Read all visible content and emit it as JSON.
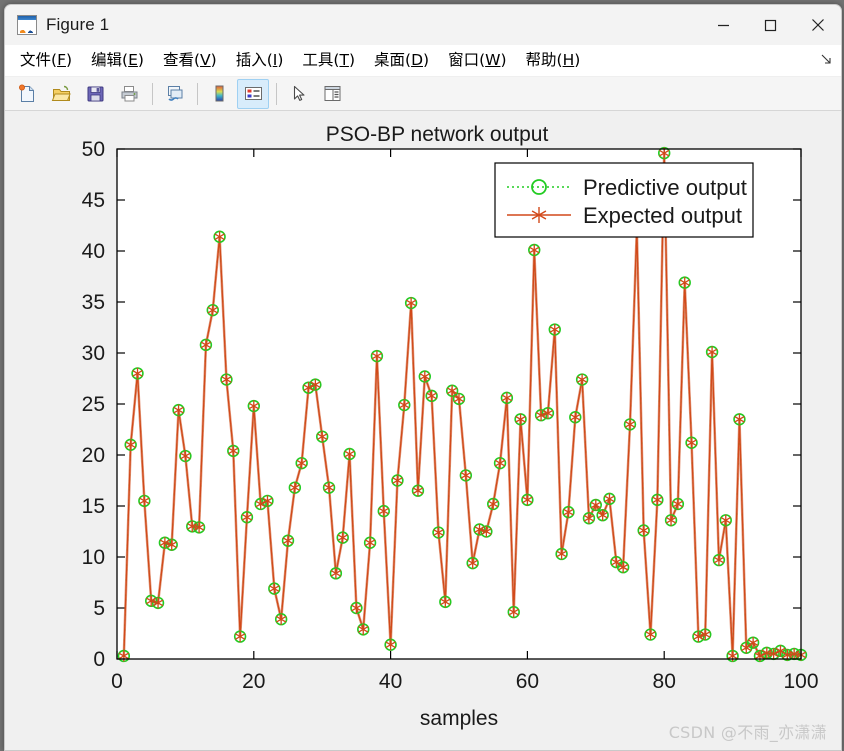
{
  "window": {
    "title": "Figure 1",
    "app_icon": "matlab-membrane-icon",
    "controls": {
      "minimize": "minimize-icon",
      "maximize": "maximize-icon",
      "close": "close-icon"
    }
  },
  "menubar": {
    "items": [
      {
        "label": "文件(F)",
        "text": "文件(",
        "accel": "F",
        "tail": ")"
      },
      {
        "label": "编辑(E)",
        "text": "编辑(",
        "accel": "E",
        "tail": ")"
      },
      {
        "label": "查看(V)",
        "text": "查看(",
        "accel": "V",
        "tail": ")"
      },
      {
        "label": "插入(I)",
        "text": "插入(",
        "accel": "I",
        "tail": ")"
      },
      {
        "label": "工具(T)",
        "text": "工具(",
        "accel": "T",
        "tail": ")"
      },
      {
        "label": "桌面(D)",
        "text": "桌面(",
        "accel": "D",
        "tail": ")"
      },
      {
        "label": "窗口(W)",
        "text": "窗口(",
        "accel": "W",
        "tail": ")"
      },
      {
        "label": "帮助(H)",
        "text": "帮助(",
        "accel": "H",
        "tail": ")"
      }
    ],
    "dock_control": "dock-arrow-icon"
  },
  "toolbar": {
    "buttons": [
      {
        "name": "new-figure-icon",
        "active": false
      },
      {
        "name": "open-file-icon",
        "active": false
      },
      {
        "name": "save-figure-icon",
        "active": false
      },
      {
        "name": "print-figure-icon",
        "active": false
      },
      {
        "name": "link-plot-icon",
        "active": false
      },
      {
        "name": "insert-colorbar-icon",
        "active": false
      },
      {
        "name": "insert-legend-icon",
        "active": true
      },
      {
        "name": "edit-pointer-icon",
        "active": false
      },
      {
        "name": "plot-browser-icon",
        "active": false
      }
    ]
  },
  "watermark": "CSDN @不雨_亦潇潇",
  "chart_data": {
    "type": "line",
    "title": "PSO-BP network output",
    "xlabel": "samples",
    "ylabel": "",
    "xlim": [
      0,
      100
    ],
    "ylim": [
      0,
      50
    ],
    "xticks": [
      0,
      20,
      40,
      60,
      80,
      100
    ],
    "yticks": [
      0,
      5,
      10,
      15,
      20,
      25,
      30,
      35,
      40,
      45,
      50
    ],
    "grid": false,
    "legend_position": "top-right",
    "colors": {
      "predictive": "#22cc22",
      "expected": "#d2491a",
      "axes_background": "#ffffff",
      "figure_background": "#f0f0f0"
    },
    "x": [
      1,
      2,
      3,
      4,
      5,
      6,
      7,
      8,
      9,
      10,
      11,
      12,
      13,
      14,
      15,
      16,
      17,
      18,
      19,
      20,
      21,
      22,
      23,
      24,
      25,
      26,
      27,
      28,
      29,
      30,
      31,
      32,
      33,
      34,
      35,
      36,
      37,
      38,
      39,
      40,
      41,
      42,
      43,
      44,
      45,
      46,
      47,
      48,
      49,
      50,
      51,
      52,
      53,
      54,
      55,
      56,
      57,
      58,
      59,
      60,
      61,
      62,
      63,
      64,
      65,
      66,
      67,
      68,
      69,
      70,
      71,
      72,
      73,
      74,
      75,
      76,
      77,
      78,
      79,
      80,
      81,
      82,
      83,
      84,
      85,
      86,
      87,
      88,
      89,
      90,
      91,
      92,
      93,
      94,
      95,
      96,
      97,
      98,
      99,
      100
    ],
    "series": [
      {
        "name": "Predictive output",
        "marker": "circle",
        "linestyle": "dotted",
        "color": "#22cc22",
        "values": [
          0.3,
          21.0,
          28.0,
          15.5,
          5.7,
          5.5,
          11.4,
          11.2,
          24.4,
          19.9,
          13.0,
          12.9,
          30.8,
          34.2,
          41.4,
          27.4,
          20.4,
          2.2,
          13.9,
          24.8,
          15.2,
          15.5,
          6.9,
          3.9,
          11.6,
          16.8,
          19.2,
          26.6,
          26.9,
          21.8,
          16.8,
          8.4,
          11.9,
          20.1,
          5.0,
          2.9,
          11.4,
          29.7,
          14.5,
          1.4,
          17.5,
          24.9,
          34.9,
          16.5,
          27.7,
          25.8,
          12.4,
          5.6,
          26.3,
          25.5,
          18.0,
          9.4,
          12.7,
          12.5,
          15.2,
          19.2,
          25.6,
          4.6,
          23.5,
          15.6,
          40.1,
          23.9,
          24.1,
          32.3,
          10.3,
          14.4,
          23.7,
          27.4,
          13.8,
          15.1,
          14.1,
          15.7,
          9.5,
          9.0,
          23.0,
          42.1,
          12.6,
          2.4,
          15.6,
          49.6,
          13.6,
          15.2,
          36.9,
          21.2,
          2.2,
          2.4,
          30.1,
          9.7,
          13.6,
          0.3,
          23.5,
          1.1,
          1.6,
          0.3,
          0.6,
          0.5,
          0.8,
          0.4,
          0.5,
          0.4
        ]
      },
      {
        "name": "Expected output",
        "marker": "asterisk",
        "linestyle": "solid",
        "color": "#d2491a",
        "values": [
          0.3,
          21.0,
          28.0,
          15.5,
          5.7,
          5.5,
          11.4,
          11.2,
          24.4,
          19.9,
          13.0,
          12.9,
          30.8,
          34.2,
          41.4,
          27.4,
          20.4,
          2.2,
          13.9,
          24.8,
          15.2,
          15.5,
          6.9,
          3.9,
          11.6,
          16.8,
          19.2,
          26.6,
          26.9,
          21.8,
          16.8,
          8.4,
          11.9,
          20.1,
          5.0,
          2.9,
          11.4,
          29.7,
          14.5,
          1.4,
          17.5,
          24.9,
          34.9,
          16.5,
          27.7,
          25.8,
          12.4,
          5.6,
          26.3,
          25.5,
          18.0,
          9.4,
          12.7,
          12.5,
          15.2,
          19.2,
          25.6,
          4.6,
          23.5,
          15.6,
          40.1,
          23.9,
          24.1,
          32.3,
          10.3,
          14.4,
          23.7,
          27.4,
          13.8,
          15.1,
          14.1,
          15.7,
          9.5,
          9.0,
          23.0,
          42.1,
          12.6,
          2.4,
          15.6,
          49.6,
          13.6,
          15.2,
          36.9,
          21.2,
          2.2,
          2.4,
          30.1,
          9.7,
          13.6,
          0.3,
          23.5,
          1.1,
          1.6,
          0.3,
          0.6,
          0.5,
          0.8,
          0.4,
          0.5,
          0.4
        ]
      }
    ]
  }
}
